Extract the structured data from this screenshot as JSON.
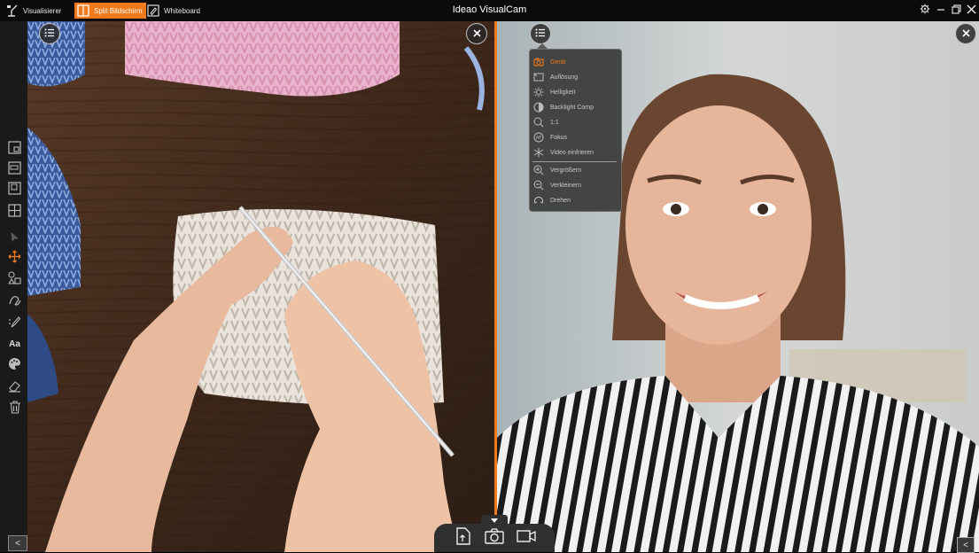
{
  "app": {
    "title": "Ideao VisualCam"
  },
  "modes": [
    {
      "label": "Visualisierer",
      "icon": "document-camera-icon"
    },
    {
      "label": "Split Bildschirm",
      "icon": "split-screen-icon",
      "active": true
    },
    {
      "label": "Whiteboard",
      "icon": "whiteboard-icon"
    }
  ],
  "window_controls": [
    "settings-icon",
    "minimize-icon",
    "restore-icon",
    "close-icon"
  ],
  "left_toolbar": {
    "tools": [
      "layout-single-icon",
      "layout-split-vertical-icon",
      "layout-split-horizontal-icon",
      "layout-quad-icon",
      "cursor-icon",
      "move-icon",
      "shapes-icon",
      "freehand-icon",
      "pen-icon",
      "text-icon",
      "palette-icon",
      "eraser-icon",
      "trash-icon"
    ],
    "collapse_label": "<",
    "text_tool_label": "Aa"
  },
  "panes": {
    "left": {
      "image": "Hands crocheting white yarn on wooden table"
    },
    "right": {
      "image": "Smiling woman in striped blouse"
    }
  },
  "camera_menu": {
    "items": [
      {
        "label": "Gerät",
        "icon": "camera-icon",
        "active": true
      },
      {
        "label": "Auflösung",
        "icon": "resolution-icon"
      },
      {
        "label": "Helligkeit",
        "icon": "brightness-icon"
      },
      {
        "label": "Backlight Comp",
        "icon": "backlight-icon"
      },
      {
        "label": "1:1",
        "icon": "zoom-reset-icon"
      },
      {
        "label": "Fokus",
        "icon": "focus-icon"
      },
      {
        "label": "Video einfrieren",
        "icon": "freeze-icon"
      },
      {
        "label": "Vergrößern",
        "icon": "zoom-in-icon"
      },
      {
        "label": "Verkleinern",
        "icon": "zoom-out-icon"
      },
      {
        "label": "Drehen",
        "icon": "rotate-icon"
      }
    ]
  },
  "bottom_bar": {
    "buttons": [
      "import-file-icon",
      "snapshot-icon",
      "record-video-icon"
    ],
    "collapse_right_label": "<"
  },
  "colors": {
    "accent": "#f07a1c",
    "toolbar": "#1a1a1a",
    "menu": "#3a3a3a"
  }
}
